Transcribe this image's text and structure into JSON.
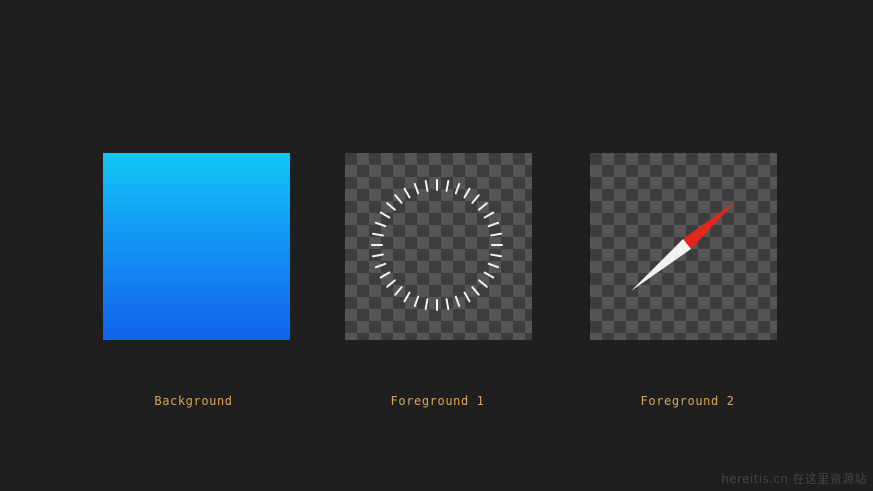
{
  "layers": {
    "background": {
      "label": "Background",
      "gradient_top": "#12c7f7",
      "gradient_bottom": "#1262ea"
    },
    "foreground1": {
      "label": "Foreground 1",
      "icon": "tick-ring-icon",
      "tick_color": "#f2f2f2"
    },
    "foreground2": {
      "label": "Foreground 2",
      "icon": "compass-needle-icon",
      "needle_red": "#e8251c",
      "needle_white": "#f2f2f2"
    }
  },
  "watermark": "hereitis.cn 在这里资源站"
}
